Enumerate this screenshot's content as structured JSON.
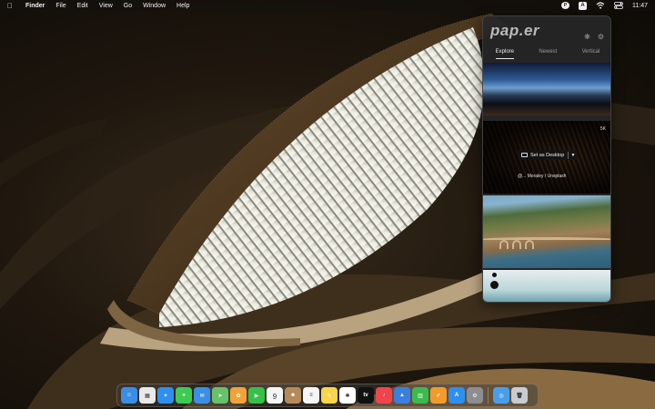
{
  "menubar": {
    "app_name": "Finder",
    "items": [
      "File",
      "Edit",
      "View",
      "Go",
      "Window",
      "Help"
    ],
    "status": {
      "input_source": "A",
      "clock": "11:47",
      "icons": [
        "papr-status-icon",
        "input-source-icon",
        "wifi-icon",
        "control-center-icon"
      ]
    }
  },
  "panel": {
    "logo": "pap.er",
    "tabs": [
      {
        "label": "Explore",
        "active": true
      },
      {
        "label": "Newest",
        "active": false
      },
      {
        "label": "Vertical",
        "active": false
      }
    ],
    "header_icons": [
      "loading-icon",
      "settings-icon"
    ],
    "wallpapers": [
      {
        "badge": ""
      },
      {
        "badge": "5K",
        "action_label": "Set as Desktop",
        "credit": "@... Moraley / Unsplash"
      },
      {
        "badge": ""
      },
      {
        "badge": ""
      }
    ]
  },
  "dock": {
    "apps": [
      {
        "name": "Finder",
        "color": "#3b8ee6",
        "glyph": "☺"
      },
      {
        "name": "Launchpad",
        "color": "#e9e9e9",
        "glyph": "▦"
      },
      {
        "name": "Safari",
        "color": "#2f8ff0",
        "glyph": "✦"
      },
      {
        "name": "Messages",
        "color": "#3ecb52",
        "glyph": "●"
      },
      {
        "name": "Mail",
        "color": "#3a8fe8",
        "glyph": "✉"
      },
      {
        "name": "Maps",
        "color": "#67c26b",
        "glyph": "➤"
      },
      {
        "name": "Photos",
        "color": "#f0a33a",
        "glyph": "✿"
      },
      {
        "name": "FaceTime",
        "color": "#35c04a",
        "glyph": "▶"
      },
      {
        "name": "Calendar",
        "color": "#f6f6f6",
        "glyph": "9"
      },
      {
        "name": "Contacts",
        "color": "#b48a5c",
        "glyph": "☻"
      },
      {
        "name": "Reminders",
        "color": "#f5f5f5",
        "glyph": "≡"
      },
      {
        "name": "Notes",
        "color": "#f8d54a",
        "glyph": "✎"
      },
      {
        "name": "Freeform",
        "color": "#ffffff",
        "glyph": "✱"
      },
      {
        "name": "TV",
        "color": "#111111",
        "glyph": "tv"
      },
      {
        "name": "Music",
        "color": "#f1444d",
        "glyph": "♪"
      },
      {
        "name": "Keynote",
        "color": "#3a7fe0",
        "glyph": "▲"
      },
      {
        "name": "Numbers",
        "color": "#3cba4e",
        "glyph": "▥"
      },
      {
        "name": "Pages",
        "color": "#f29b2b",
        "glyph": "✐"
      },
      {
        "name": "App Store",
        "color": "#2f8ff0",
        "glyph": "A"
      },
      {
        "name": "System Settings",
        "color": "#8d8d92",
        "glyph": "⚙"
      },
      {
        "name": "Screenshot",
        "color": "#4a9ee8",
        "glyph": "◎"
      },
      {
        "name": "Trash",
        "color": "#c9ccd0",
        "glyph": "🗑"
      }
    ]
  }
}
